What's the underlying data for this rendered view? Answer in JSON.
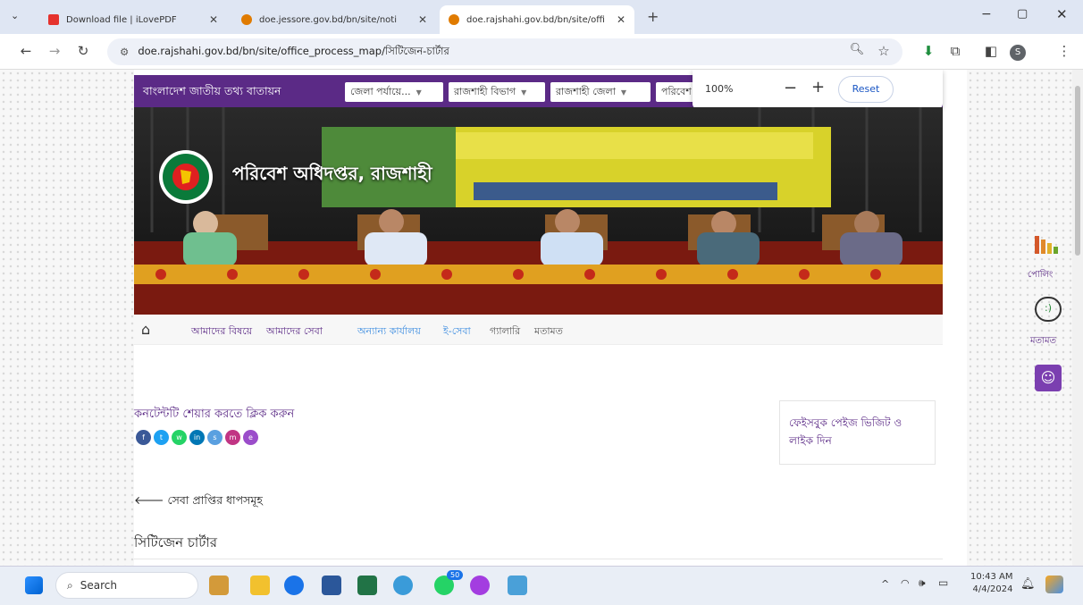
{
  "browser": {
    "tabs": [
      {
        "title": "Download file | iLovePDF",
        "active": false
      },
      {
        "title": "doe.jessore.gov.bd/bn/site/noti",
        "active": false
      },
      {
        "title": "doe.rajshahi.gov.bd/bn/site/offi",
        "active": true
      }
    ],
    "url": "doe.rajshahi.gov.bd/bn/site/office_process_map/সিটিজেন-চার্টার",
    "profile_initial": "S"
  },
  "zoom_popup": {
    "level": "100%",
    "minus": "−",
    "plus": "+",
    "reset": "Reset"
  },
  "site": {
    "brand": "বাংলাদেশ জাতীয় তথ্য বাতায়ন",
    "selects": [
      "জেলা পর্যায়ে...",
      "রাজশাহী বিভাগ",
      "রাজশাহী জেলা",
      "পরিবেশ"
    ],
    "banner_title": "পরিবেশ অধিদপ্তর, রাজশাহী",
    "nav": [
      "আমাদের বিষয়ে",
      "আমাদের সেবা",
      "অন্যান্য কার্যালয়",
      "ই-সেবা",
      "গ্যালারি",
      "মতামত"
    ],
    "share_text": "কনটেন্টটি শেয়ার করতে ক্লিক করুন",
    "share_icons": [
      "f",
      "t",
      "w",
      "in",
      "s",
      "m",
      "e"
    ],
    "facebook_box": "ফেইসবুক পেইজ ভিজিট ও লাইক দিন",
    "back_link": "সেবা প্রাপ্তির ধাপসমূহ",
    "section_title": "সিটিজেন চার্টার",
    "right_side": {
      "poll": "পোলিং",
      "feedback": "মতামত"
    }
  },
  "taskbar": {
    "search": "Search",
    "time": "10:43 AM",
    "date": "4/4/2024",
    "badge": "50"
  },
  "colors": {
    "purple": "#5b2a86",
    "tab_bg": "#dfe6f3"
  }
}
